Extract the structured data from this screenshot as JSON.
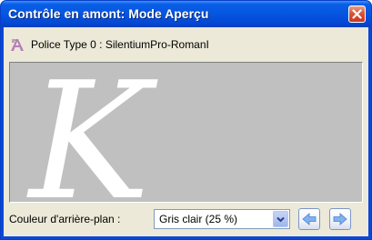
{
  "window": {
    "title": "Contrôle en amont: Mode Aperçu"
  },
  "font_info": {
    "label": "Police Type 0 : SilentiumPro-RomanI"
  },
  "preview": {
    "glyph": "K",
    "background_color": "#c0c0c0",
    "glyph_color": "#ffffff"
  },
  "background_selector": {
    "label": "Couleur d'arrière-plan :",
    "selected": "Gris clair (25 %)"
  },
  "icons": {
    "close": "close-icon",
    "font": "font-icon",
    "dropdown": "chevron-down-icon",
    "previous": "arrow-left-icon",
    "next": "arrow-right-icon"
  },
  "colors": {
    "titlebar": "#0555e0",
    "client_background": "#ece9d8",
    "close_button": "#d8553a",
    "nav_arrow": "#7fb2f0"
  }
}
